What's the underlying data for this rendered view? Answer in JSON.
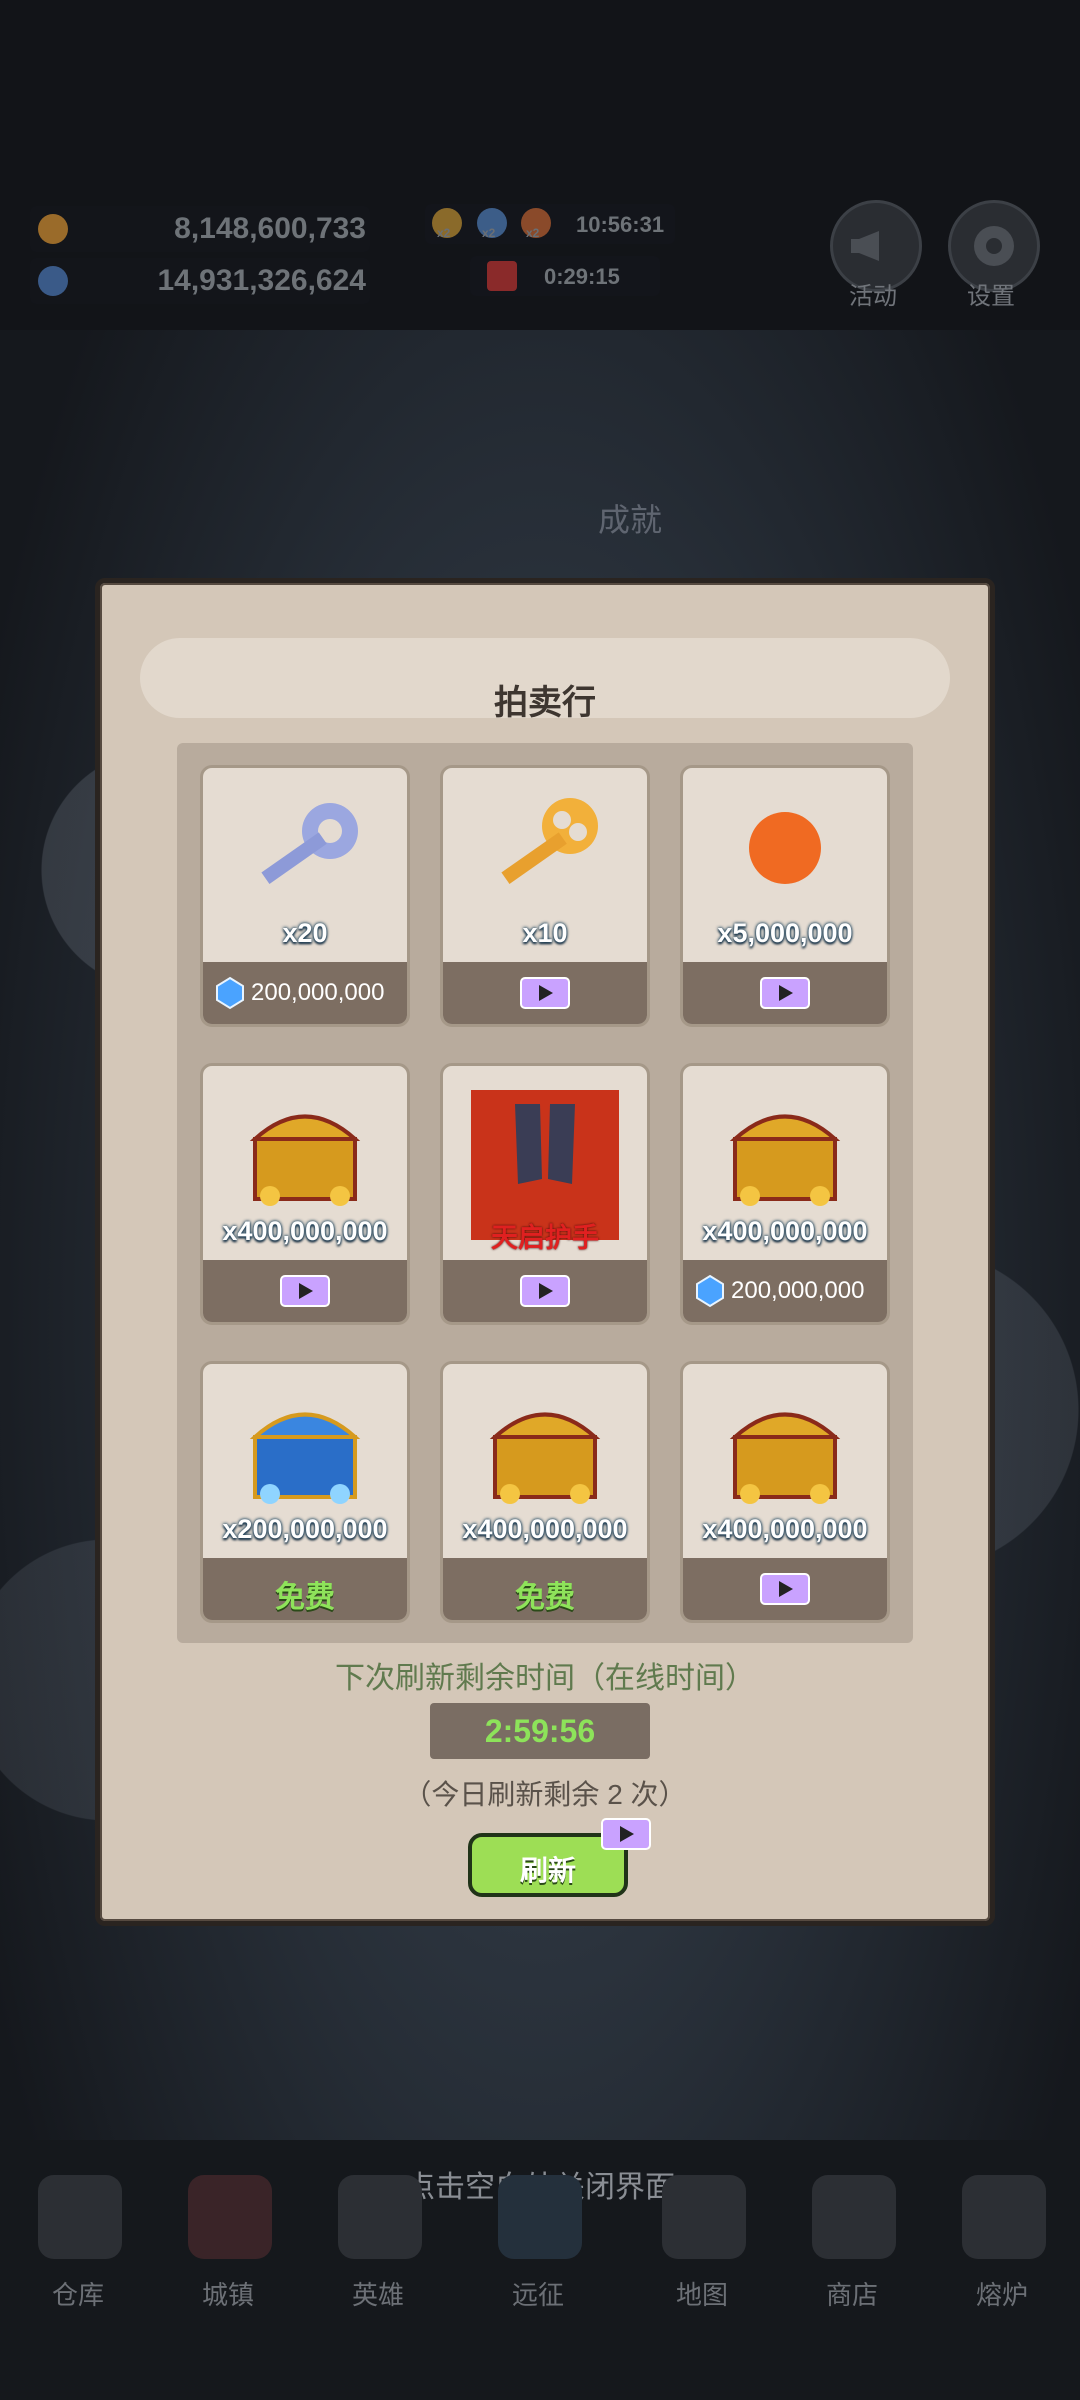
{
  "top": {
    "gold_value": "8,148,600,733",
    "gem_value": "14,931,326,624",
    "boost_clock": "10:56:31",
    "boost_multiplier": "x2",
    "gift_timer": "0:29:15",
    "activity_label": "活动",
    "settings_label": "设置"
  },
  "background": {
    "achievement_title": "成就"
  },
  "panel": {
    "title": "拍卖行",
    "items": [
      {
        "qty": "x20",
        "price_type": "gem",
        "price": "200,000,000"
      },
      {
        "qty": "x10",
        "price_type": "video",
        "price": ""
      },
      {
        "qty": "x5,000,000",
        "price_type": "video",
        "price": ""
      },
      {
        "qty": "x400,000,000",
        "price_type": "video",
        "price": ""
      },
      {
        "qty": "天启护手",
        "price_type": "video",
        "price": ""
      },
      {
        "qty": "x400,000,000",
        "price_type": "gem",
        "price": "200,000,000"
      },
      {
        "qty": "x200,000,000",
        "price_type": "free",
        "price": "免费"
      },
      {
        "qty": "x400,000,000",
        "price_type": "free",
        "price": "免费"
      },
      {
        "qty": "x400,000,000",
        "price_type": "video",
        "price": ""
      }
    ],
    "refresh_label": "下次刷新剩余时间（在线时间）",
    "countdown": "2:59:56",
    "remaining_text": "（今日刷新剩余 2 次）",
    "refresh_button": "刷新"
  },
  "close_hint": "点击空白处关闭界面",
  "nav": [
    {
      "label": "仓库"
    },
    {
      "label": "城镇"
    },
    {
      "label": "英雄"
    },
    {
      "label": "远征"
    },
    {
      "label": "地图"
    },
    {
      "label": "商店"
    },
    {
      "label": "熔炉"
    }
  ],
  "colors": {
    "panel_bg": "#d4c7b8",
    "free_green": "#8ee35a",
    "price_bar": "#7d6e62",
    "refresh_button": "#9dde55"
  }
}
